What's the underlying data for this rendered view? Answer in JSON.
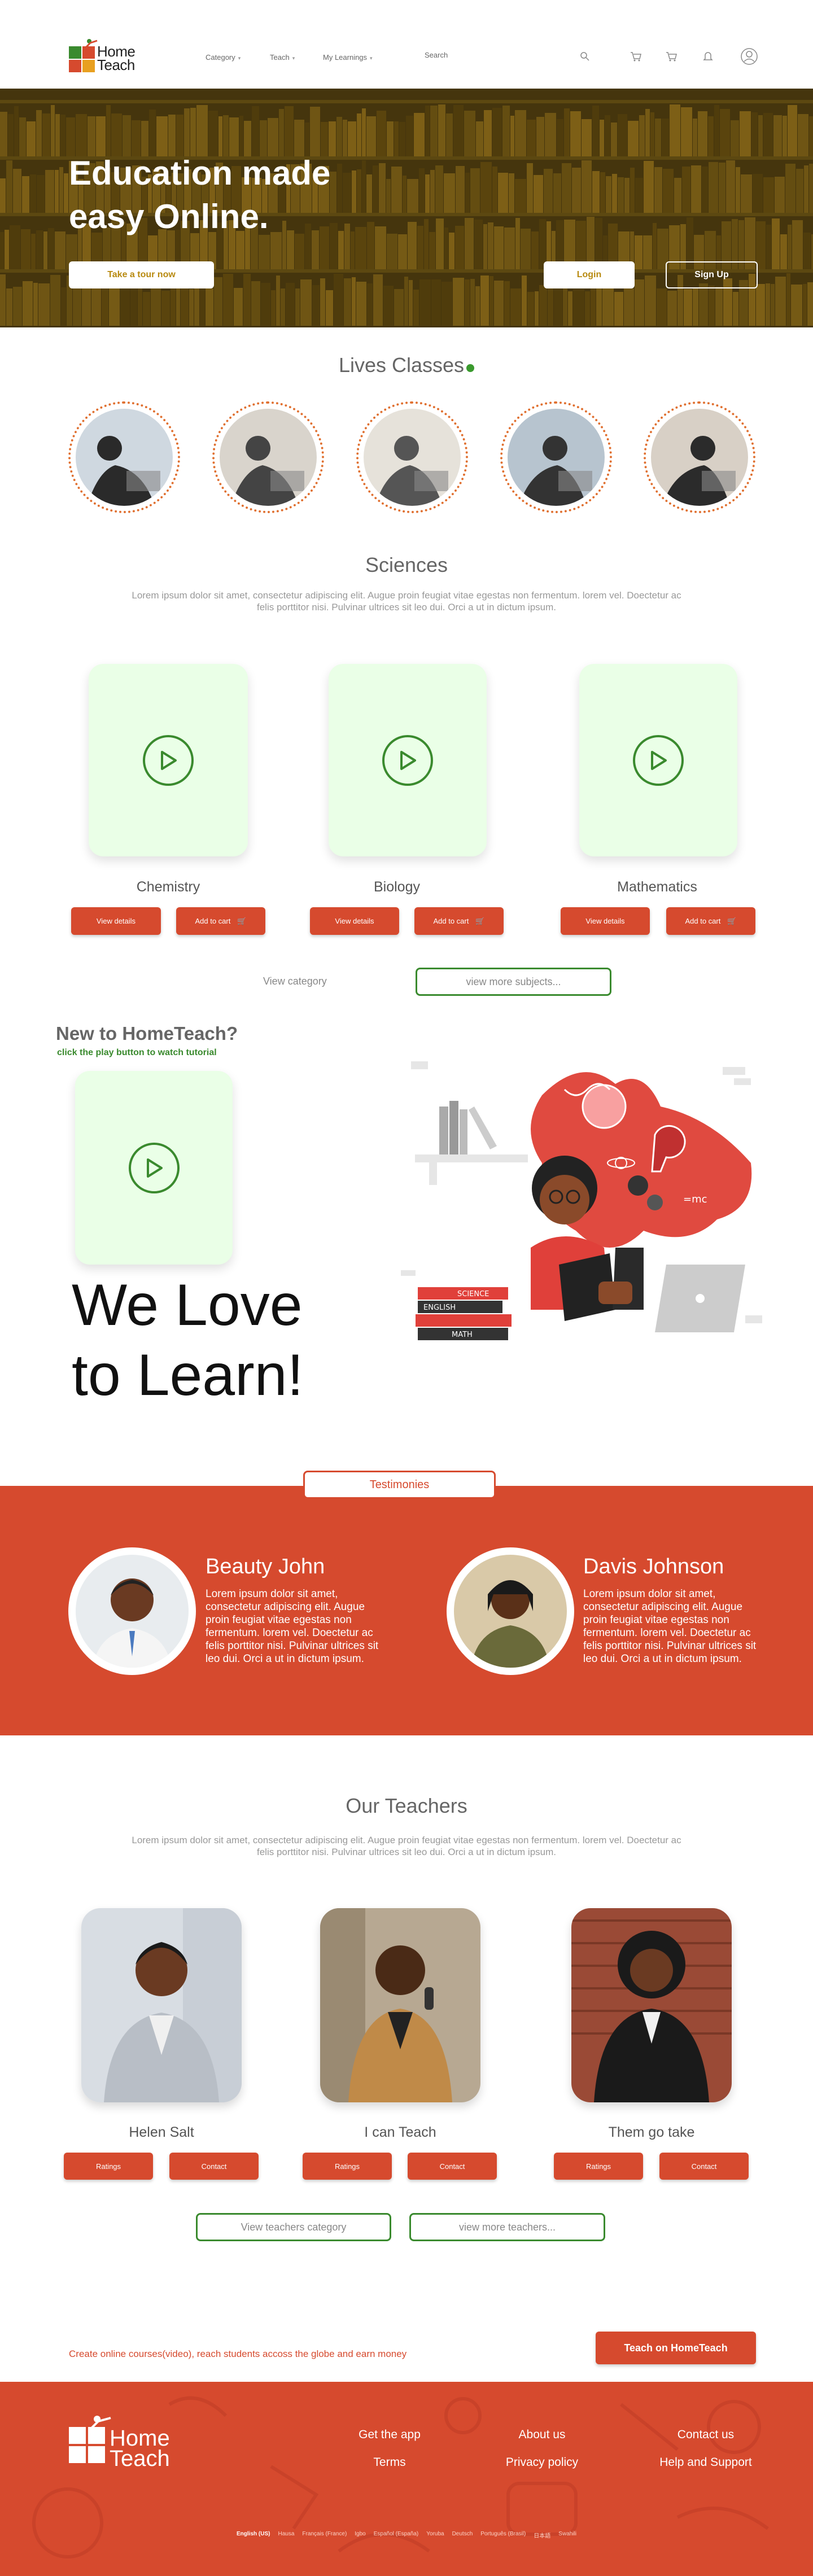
{
  "nav": {
    "logo_top": "Home",
    "logo_bottom": "Teach",
    "links": [
      {
        "label": "Category"
      },
      {
        "label": "Teach"
      },
      {
        "label": "My Learnings"
      }
    ],
    "search_placeholder": "Search"
  },
  "hero": {
    "title_line1": "Education made",
    "title_line2": "easy Online.",
    "tour_button": "Take a tour now",
    "login_button": "Login",
    "signup_button": "Sign Up"
  },
  "live": {
    "title": "Lives Classes",
    "live_dot_color": "#3a9a2e"
  },
  "sciences": {
    "title": "Sciences",
    "text": "Lorem ipsum dolor sit amet, consectetur adipiscing elit. Augue proin feugiat vitae egestas non fermentum. lorem vel. Doectetur ac felis porttitor nisi. Pulvinar ultrices sit leo dui. Orci a ut in dictum ipsum.",
    "subjects": [
      {
        "name": "Chemistry",
        "details": "View details",
        "cart": "Add to cart"
      },
      {
        "name": "Biology",
        "details": "View details",
        "cart": "Add to cart"
      },
      {
        "name": "Mathematics",
        "details": "View details",
        "cart": "Add to cart"
      }
    ],
    "view_category": "View category",
    "view_more": "view more subjects..."
  },
  "new_section": {
    "title": "New to HomeTeach?",
    "subtitle": "click the play button to watch tutorial",
    "big_line1": "We Love",
    "big_line2": "to Learn!",
    "book_labels": [
      "SCIENCE",
      "ENGLISH",
      "MATH"
    ]
  },
  "testimonies": {
    "label": "Testimonies",
    "items": [
      {
        "name": "Beauty John",
        "text": "Lorem ipsum dolor sit amet, consectetur adipiscing elit. Augue proin feugiat vitae egestas non fermentum. lorem vel. Doectetur ac felis porttitor nisi. Pulvinar ultrices sit leo dui. Orci a ut in dictum ipsum."
      },
      {
        "name": "Davis Johnson",
        "text": "Lorem ipsum dolor sit amet, consectetur adipiscing elit. Augue proin feugiat vitae egestas non fermentum. lorem vel. Doectetur ac felis porttitor nisi. Pulvinar ultrices sit leo dui. Orci a ut in dictum ipsum."
      }
    ]
  },
  "teachers": {
    "title": "Our Teachers",
    "text": "Lorem ipsum dolor sit amet, consectetur adipiscing elit. Augue proin feugiat vitae egestas non fermentum. lorem vel. Doectetur ac felis porttitor nisi. Pulvinar ultrices sit leo dui. Orci a ut in dictum ipsum.",
    "items": [
      {
        "name": "Helen Salt",
        "ratings": "Ratings",
        "contact": "Contact"
      },
      {
        "name": "I can Teach",
        "ratings": "Ratings",
        "contact": "Contact"
      },
      {
        "name": "Them go take",
        "ratings": "Ratings",
        "contact": "Contact"
      }
    ],
    "view_category": "View teachers category",
    "view_more": "view more teachers..."
  },
  "cta": {
    "text": "Create online courses(video), reach students accoss the globe and earn money",
    "button": "Teach on HomeTeach"
  },
  "footer": {
    "logo_top": "Home",
    "logo_bottom": "Teach",
    "links": [
      "Get the app",
      "About us",
      "Contact us",
      "Terms",
      "Privacy policy",
      "Help and Support"
    ],
    "languages": [
      "English (US)",
      "Hausa",
      "Français (France)",
      "Igbo",
      "Español (España)",
      "Yoruba",
      "Deutsch",
      "Português (Brasil)",
      "日本語",
      "Swahili"
    ]
  },
  "colors": {
    "brand_red": "#d64a2e",
    "brand_green": "#3a8a2e",
    "card_mint": "#eaffe7",
    "hero_gold": "#b88a10"
  }
}
